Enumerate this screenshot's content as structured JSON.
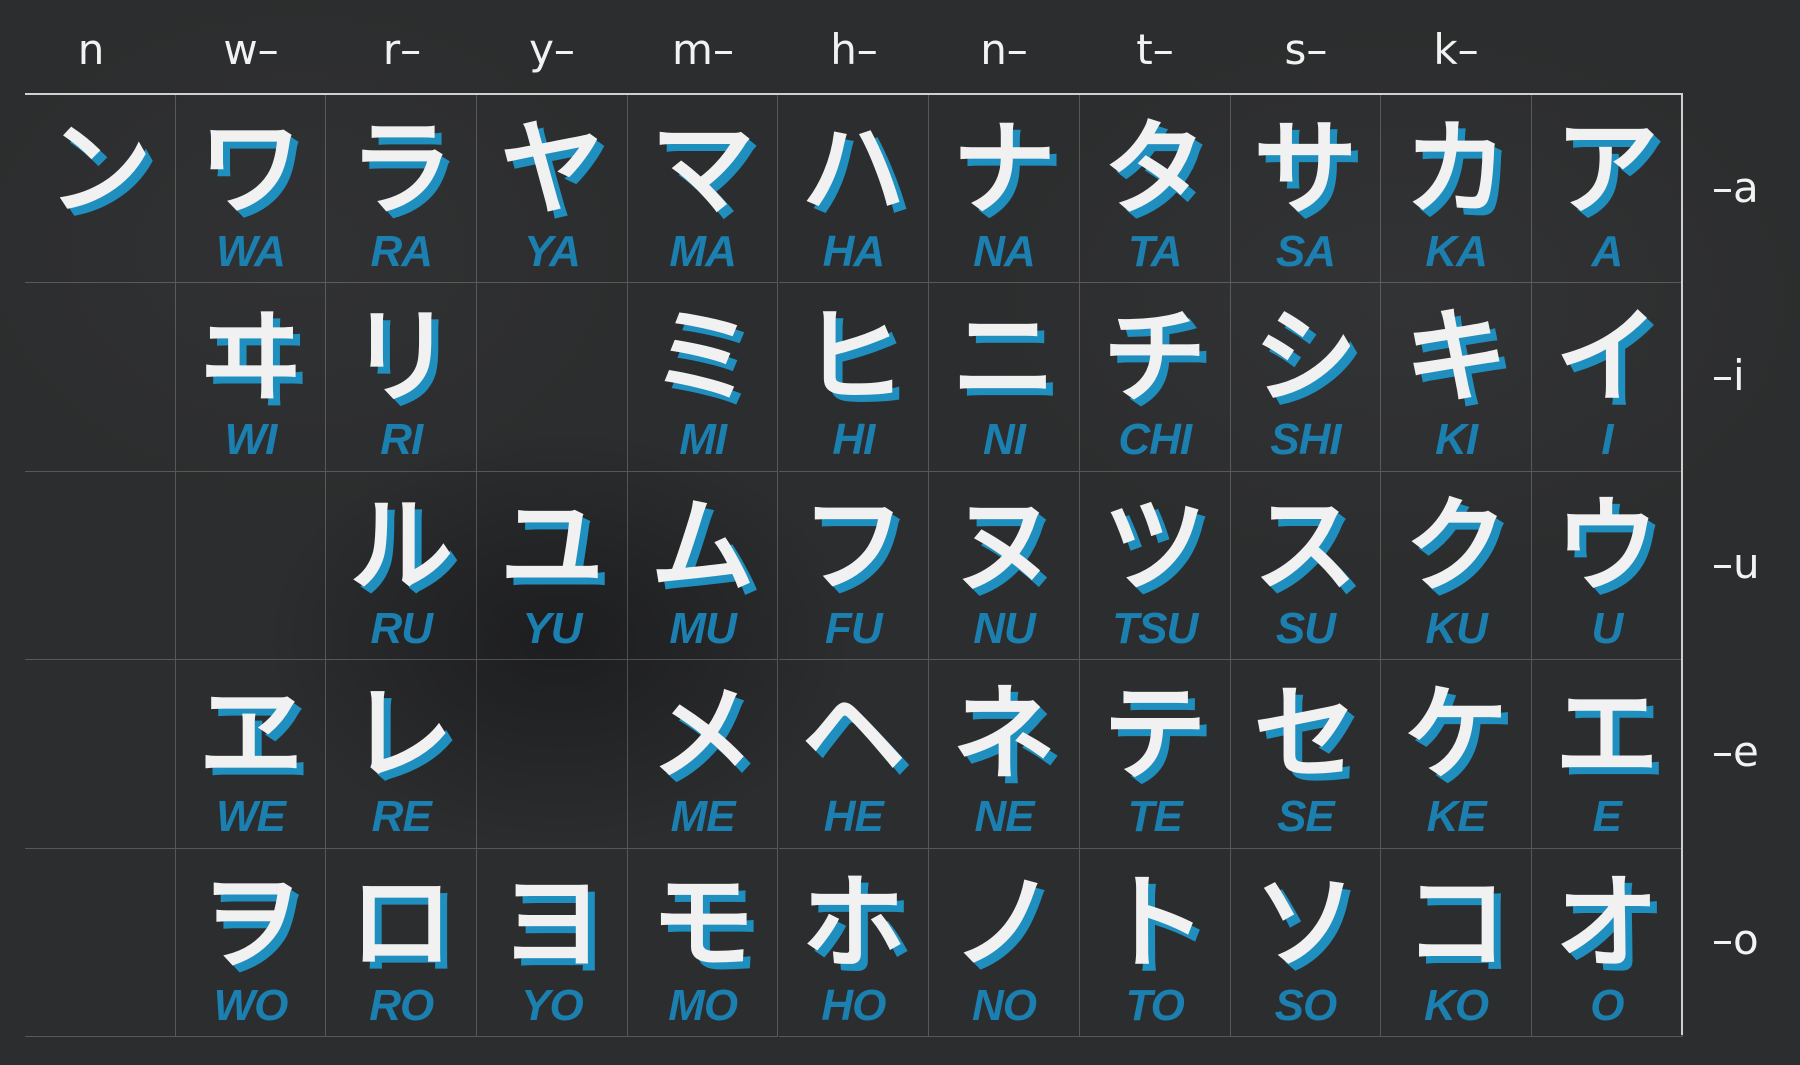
{
  "column_headers": [
    "n",
    "w–",
    "r–",
    "y–",
    "m–",
    "h–",
    "n–",
    "t–",
    "s–",
    "k–",
    ""
  ],
  "row_headers": [
    "–a",
    "–i",
    "–u",
    "–e",
    "–o"
  ],
  "colors": {
    "board": "#2c2d2e",
    "kana_text": "#f1f1f1",
    "kana_shadow": "#1f8fc0",
    "romaji_text": "#1b7fb0",
    "grid_line": "#cfd0d0"
  },
  "rows": [
    [
      {
        "kana": "ン",
        "romaji": ""
      },
      {
        "kana": "ワ",
        "romaji": "WA"
      },
      {
        "kana": "ラ",
        "romaji": "RA"
      },
      {
        "kana": "ヤ",
        "romaji": "YA"
      },
      {
        "kana": "マ",
        "romaji": "MA"
      },
      {
        "kana": "ハ",
        "romaji": "HA"
      },
      {
        "kana": "ナ",
        "romaji": "NA"
      },
      {
        "kana": "タ",
        "romaji": "TA"
      },
      {
        "kana": "サ",
        "romaji": "SA"
      },
      {
        "kana": "カ",
        "romaji": "KA"
      },
      {
        "kana": "ア",
        "romaji": "A"
      }
    ],
    [
      {
        "kana": "",
        "romaji": ""
      },
      {
        "kana": "ヰ",
        "romaji": "WI"
      },
      {
        "kana": "リ",
        "romaji": "RI"
      },
      {
        "kana": "",
        "romaji": ""
      },
      {
        "kana": "ミ",
        "romaji": "MI"
      },
      {
        "kana": "ヒ",
        "romaji": "HI"
      },
      {
        "kana": "ニ",
        "romaji": "NI"
      },
      {
        "kana": "チ",
        "romaji": "CHI"
      },
      {
        "kana": "シ",
        "romaji": "SHI"
      },
      {
        "kana": "キ",
        "romaji": "KI"
      },
      {
        "kana": "イ",
        "romaji": "I"
      }
    ],
    [
      {
        "kana": "",
        "romaji": ""
      },
      {
        "kana": "",
        "romaji": ""
      },
      {
        "kana": "ル",
        "romaji": "RU"
      },
      {
        "kana": "ユ",
        "romaji": "YU"
      },
      {
        "kana": "ム",
        "romaji": "MU"
      },
      {
        "kana": "フ",
        "romaji": "FU"
      },
      {
        "kana": "ヌ",
        "romaji": "NU"
      },
      {
        "kana": "ツ",
        "romaji": "TSU"
      },
      {
        "kana": "ス",
        "romaji": "SU"
      },
      {
        "kana": "ク",
        "romaji": "KU"
      },
      {
        "kana": "ウ",
        "romaji": "U"
      }
    ],
    [
      {
        "kana": "",
        "romaji": ""
      },
      {
        "kana": "ヱ",
        "romaji": "WE"
      },
      {
        "kana": "レ",
        "romaji": "RE"
      },
      {
        "kana": "",
        "romaji": ""
      },
      {
        "kana": "メ",
        "romaji": "ME"
      },
      {
        "kana": "ヘ",
        "romaji": "HE"
      },
      {
        "kana": "ネ",
        "romaji": "NE"
      },
      {
        "kana": "テ",
        "romaji": "TE"
      },
      {
        "kana": "セ",
        "romaji": "SE"
      },
      {
        "kana": "ケ",
        "romaji": "KE"
      },
      {
        "kana": "エ",
        "romaji": "E"
      }
    ],
    [
      {
        "kana": "",
        "romaji": ""
      },
      {
        "kana": "ヲ",
        "romaji": "WO"
      },
      {
        "kana": "ロ",
        "romaji": "RO"
      },
      {
        "kana": "ヨ",
        "romaji": "YO"
      },
      {
        "kana": "モ",
        "romaji": "MO"
      },
      {
        "kana": "ホ",
        "romaji": "HO"
      },
      {
        "kana": "ノ",
        "romaji": "NO"
      },
      {
        "kana": "ト",
        "romaji": "TO"
      },
      {
        "kana": "ソ",
        "romaji": "SO"
      },
      {
        "kana": "コ",
        "romaji": "KO"
      },
      {
        "kana": "オ",
        "romaji": "O"
      }
    ]
  ]
}
